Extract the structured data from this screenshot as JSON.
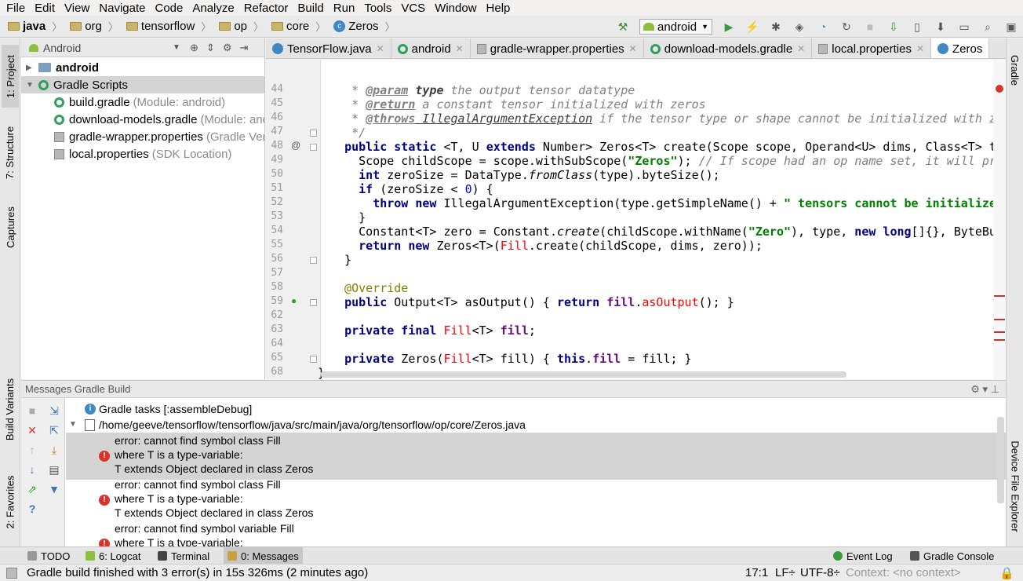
{
  "menu": [
    "File",
    "Edit",
    "View",
    "Navigate",
    "Code",
    "Analyze",
    "Refactor",
    "Build",
    "Run",
    "Tools",
    "VCS",
    "Window",
    "Help"
  ],
  "breadcrumb": [
    "java",
    "org",
    "tensorflow",
    "op",
    "core",
    "Zeros"
  ],
  "toolbar": {
    "run_config": "android"
  },
  "left_tabs": {
    "project": "1: Project",
    "structure": "7: Structure",
    "captures": "Captures",
    "build_variants": "Build Variants",
    "favorites": "2: Favorites"
  },
  "right_tabs": {
    "gradle": "Gradle",
    "device_file_explorer": "Device File Explorer"
  },
  "project": {
    "view_mode": "Android",
    "items": [
      {
        "label": "android",
        "note": ""
      },
      {
        "label": "Gradle Scripts",
        "note": ""
      },
      {
        "label": "build.gradle",
        "note": "(Module: android)"
      },
      {
        "label": "download-models.gradle",
        "note": "(Module: android)"
      },
      {
        "label": "gradle-wrapper.properties",
        "note": "(Gradle Version)"
      },
      {
        "label": "local.properties",
        "note": "(SDK Location)"
      }
    ]
  },
  "tabs": [
    "TensorFlow.java",
    "android",
    "gradle-wrapper.properties",
    "download-models.gradle",
    "local.properties",
    "Zeros"
  ],
  "editor": {
    "line_numbers": [
      "44",
      "45",
      "46",
      "47",
      "48",
      "49",
      "50",
      "51",
      "52",
      "53",
      "54",
      "55",
      "56",
      "57",
      "58",
      "59",
      "62",
      "63",
      "64",
      "65",
      "68"
    ],
    "code": {
      "l44a": "   * ",
      "l44b": "@param",
      "l44c": " ",
      "l44d": "type",
      "l44e": " the output tensor datatype",
      "l45a": "   * ",
      "l45b": "@return",
      "l45c": " a constant tensor initialized with zeros",
      "l46a": "   * ",
      "l46b": "@throws",
      "l46c": " IllegalArgumentException",
      "l46d": " if the tensor type or shape cannot be initialized with zeros.",
      "l47": "   */",
      "l48a": "  ",
      "l48b": "public static",
      "l48c": " <T, U ",
      "l48d": "extends",
      "l48e": " Number> Zeros<T> create(Scope scope, Operand<U> dims, Class<T> type) {",
      "l49a": "    Scope childScope = scope.withSubScope(",
      "l49b": "\"Zeros\"",
      "l49c": "); ",
      "l49d": "// If scope had an op name set, it will prevail on \"Zeros\"",
      "l50a": "    ",
      "l50b": "int",
      "l50c": " zeroSize = DataType.",
      "l50d": "fromClass",
      "l50e": "(type).byteSize();",
      "l51a": "    ",
      "l51b": "if",
      "l51c": " (zeroSize < ",
      "l51d": "0",
      "l51e": ") {",
      "l52a": "      ",
      "l52b": "throw new",
      "l52c": " IllegalArgumentException(type.getSimpleName() + ",
      "l52d": "\" tensors cannot be initialized with zeros\"",
      "l53": "    }",
      "l54a": "    Constant<T> zero = Constant.",
      "l54b": "create",
      "l54c": "(childScope.withName(",
      "l54d": "\"Zero\"",
      "l54e": "), type, ",
      "l54f": "new long",
      "l54g": "[]{}, ByteBuffer.allocate(zeroSize));",
      "l55a": "    ",
      "l55b": "return new",
      "l55c": " Zeros<T>(",
      "l55d": "Fill",
      "l55e": ".create(childScope, dims, zero));",
      "l56": "  }",
      "l58": "  @Override",
      "l59a": "  ",
      "l59b": "public",
      "l59c": " Output<T> asOutput() { ",
      "l59d": "return",
      "l59e": " ",
      "l59f": "fill",
      "l59g": ".",
      "l59h": "asOutput",
      "l59i": "(); }",
      "l63a": "  ",
      "l63b": "private final",
      "l63c": " ",
      "l63d": "Fill",
      "l63e": "<T> ",
      "l63f": "fill",
      "l63g": ";",
      "l65a": "  ",
      "l65b": "private",
      "l65c": " Zeros(",
      "l65d": "Fill",
      "l65e": "<T> fill) { ",
      "l65f": "this",
      "l65g": ".",
      "l65h": "fill",
      "l65i": " = fill; }",
      "l68": "}"
    }
  },
  "messages": {
    "title": "Messages Gradle Build",
    "task": "Gradle tasks [:assembleDebug]",
    "file": "/home/geeve/tensorflow/tensorflow/java/src/main/java/org/tensorflow/op/core/Zeros.java",
    "errors": [
      [
        "error: cannot find symbol class Fill",
        "where T is a type-variable:",
        "T extends Object declared in class Zeros"
      ],
      [
        "error: cannot find symbol class Fill",
        "where T is a type-variable:",
        "T extends Object declared in class Zeros"
      ],
      [
        "error: cannot find symbol variable Fill",
        "where T is a type-variable:"
      ]
    ]
  },
  "bottom_tabs": {
    "todo": "TODO",
    "logcat": "6: Logcat",
    "terminal": "Terminal",
    "messages": "0: Messages",
    "event_log": "Event Log",
    "gradle_console": "Gradle Console"
  },
  "status": {
    "message": "Gradle build finished with 3 error(s) in 15s 326ms (2 minutes ago)",
    "position": "17:1",
    "line_sep": "LF÷",
    "encoding": "UTF-8÷",
    "context": "Context: <no context>"
  },
  "colors": {
    "keyword": "#000080",
    "string": "#008000",
    "comment": "#808080",
    "error": "#d9342b",
    "selection": "#d4d4d4"
  }
}
